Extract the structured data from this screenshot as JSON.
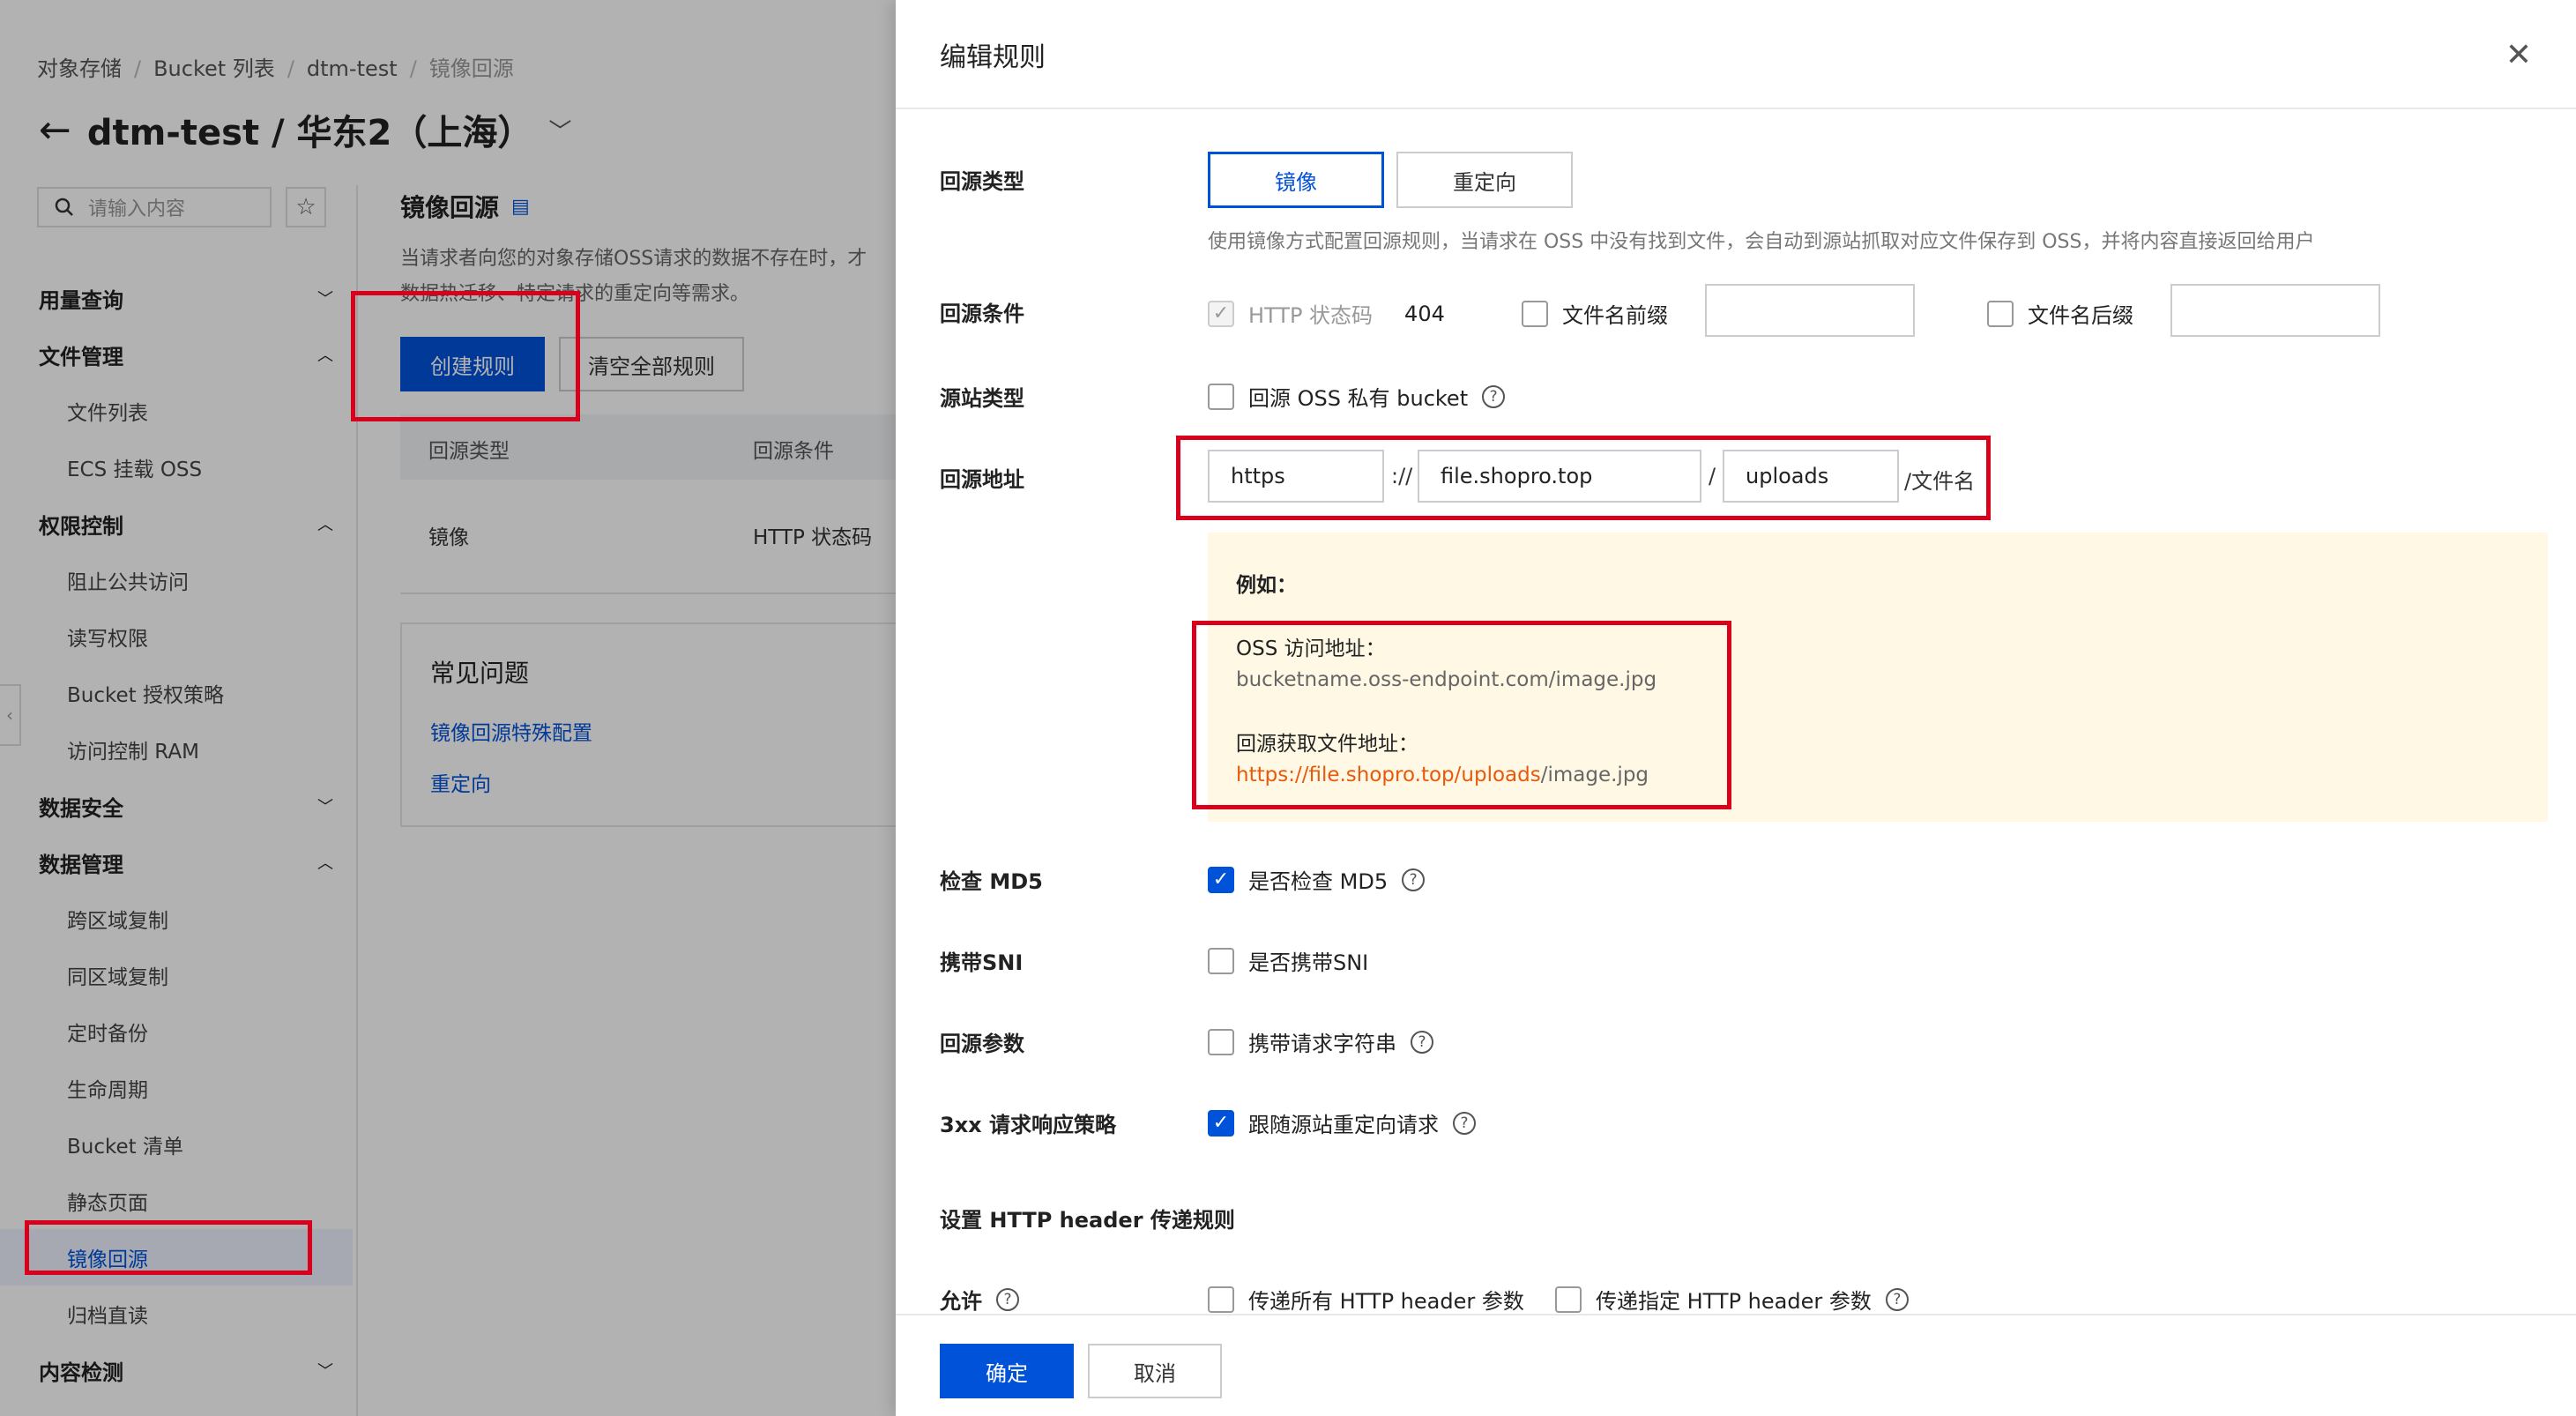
{
  "breadcrumb": [
    "对象存储",
    "Bucket 列表",
    "dtm-test",
    "镜像回源"
  ],
  "page": {
    "title": "dtm-test / 华东2（上海）"
  },
  "sidebar": {
    "search_placeholder": "请输入内容",
    "groups": [
      {
        "label": "用量查询",
        "expanded": false,
        "items": []
      },
      {
        "label": "文件管理",
        "expanded": true,
        "items": [
          "文件列表",
          "ECS 挂载 OSS"
        ]
      },
      {
        "label": "权限控制",
        "expanded": true,
        "items": [
          "阻止公共访问",
          "读写权限",
          "Bucket 授权策略",
          "访问控制 RAM"
        ]
      },
      {
        "label": "数据安全",
        "expanded": false,
        "items": []
      },
      {
        "label": "数据管理",
        "expanded": true,
        "items": [
          "跨区域复制",
          "同区域复制",
          "定时备份",
          "生命周期",
          "Bucket 清单",
          "静态页面",
          "镜像回源",
          "归档直读"
        ]
      },
      {
        "label": "内容检测",
        "expanded": false,
        "items": []
      }
    ],
    "active_item": "镜像回源"
  },
  "main": {
    "section_title": "镜像回源",
    "desc_line1": "当请求者向您的对象存储OSS请求的数据不存在时，才",
    "desc_line2": "数据热迁移、特定请求的重定向等需求。",
    "create_btn": "创建规则",
    "clear_btn": "清空全部规则",
    "table": {
      "headers": [
        "回源类型",
        "回源条件"
      ],
      "rows": [
        [
          "镜像",
          "HTTP 状态码"
        ]
      ]
    },
    "faq": {
      "title": "常见问题",
      "links": [
        "镜像回源特殊配置",
        "重定向"
      ]
    }
  },
  "drawer": {
    "title": "编辑规则",
    "origin_type": {
      "label": "回源类型",
      "options": [
        "镜像",
        "重定向"
      ],
      "selected": "镜像",
      "desc": "使用镜像方式配置回源规则，当请求在 OSS 中没有找到文件，会自动到源站抓取对应文件保存到 OSS，并将内容直接返回给用户"
    },
    "origin_condition": {
      "label": "回源条件",
      "http_status_label": "HTTP 状态码",
      "http_status_value": "404",
      "prefix_label": "文件名前缀",
      "prefix_value": "",
      "suffix_label": "文件名后缀",
      "suffix_value": ""
    },
    "source_type": {
      "label": "源站类型",
      "option": "回源 OSS 私有 bucket",
      "checked": false
    },
    "origin_address": {
      "label": "回源地址",
      "protocol": "https",
      "sep1": "://",
      "domain": "file.shopro.top",
      "sep2": "/",
      "path": "uploads",
      "suffix": "/文件名"
    },
    "example": {
      "title": "例如：",
      "oss_label": "OSS 访问地址：",
      "oss_url": "bucketname.oss-endpoint.com/image.jpg",
      "fetch_label": "回源获取文件地址：",
      "fetch_protocol": "https://",
      "fetch_domain": "file.shopro.top/",
      "fetch_path": "uploads",
      "fetch_file": "/image.jpg"
    },
    "check_md5": {
      "label": "检查 MD5",
      "option": "是否检查 MD5",
      "checked": true
    },
    "sni": {
      "label": "携带SNI",
      "option": "是否携带SNI",
      "checked": false
    },
    "params": {
      "label": "回源参数",
      "option": "携带请求字符串",
      "checked": false
    },
    "redirect_3xx": {
      "label": "3xx 请求响应策略",
      "option": "跟随源站重定向请求",
      "checked": true
    },
    "header_section": "设置 HTTP header 传递规则",
    "allow": {
      "label": "允许",
      "option1": "传递所有 HTTP header 参数",
      "option2": "传递指定 HTTP header 参数"
    },
    "ok_btn": "确定",
    "cancel_btn": "取消"
  },
  "colors": {
    "primary": "#0052d9",
    "highlight": "#d9001b",
    "tip_bg": "#fff8e4",
    "link_orange": "#e8590c"
  }
}
